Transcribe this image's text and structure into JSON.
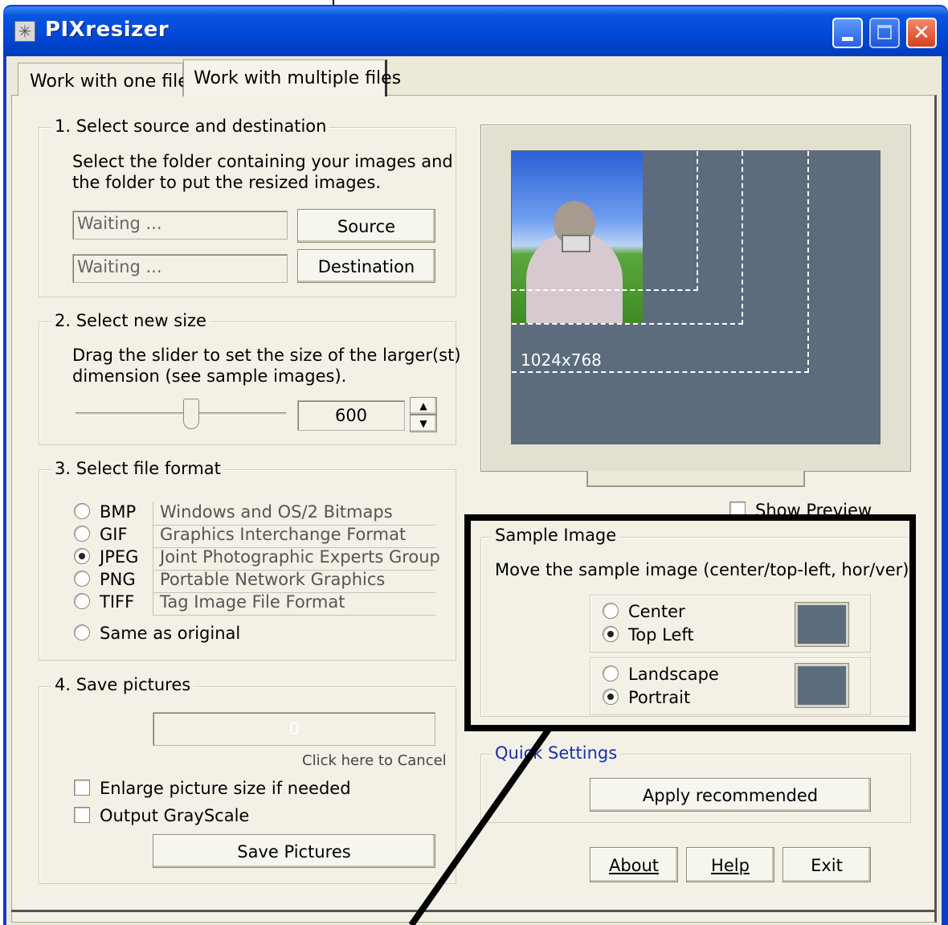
{
  "window": {
    "title": "PIXresizer"
  },
  "tabs": [
    {
      "label": "Work with one file"
    },
    {
      "label": "Work with multiple files"
    }
  ],
  "step1": {
    "legend": "1. Select source and destination",
    "instructions_line1": "Select the folder containing your images and",
    "instructions_line2": "the folder to put the resized images.",
    "source_value": "Waiting ...",
    "destination_value": "Waiting ...",
    "source_button": "Source",
    "destination_button": "Destination"
  },
  "step2": {
    "legend": "2. Select new size",
    "instructions_line1": "Drag the slider to set the size of the larger(st)",
    "instructions_line2": "dimension (see sample images).",
    "size_value": "600"
  },
  "step3": {
    "legend": "3. Select file format",
    "formats": [
      {
        "name": "BMP",
        "desc": "Windows and OS/2 Bitmaps",
        "selected": false
      },
      {
        "name": "GIF",
        "desc": "Graphics Interchange Format",
        "selected": false
      },
      {
        "name": "JPEG",
        "desc": "Joint Photographic Experts Group",
        "selected": true
      },
      {
        "name": "PNG",
        "desc": "Portable Network Graphics",
        "selected": false
      },
      {
        "name": "TIFF",
        "desc": "Tag Image File Format",
        "selected": false
      }
    ],
    "same_as_original": "Same as original"
  },
  "step4": {
    "legend": "4. Save pictures",
    "progress_value": "0",
    "cancel_text": "Click here to Cancel",
    "enlarge_label": "Enlarge picture size if needed",
    "grayscale_label": "Output GrayScale",
    "save_button": "Save Pictures"
  },
  "preview": {
    "resolution_label": "1024x768",
    "show_preview_label": "Show Preview"
  },
  "sample_image": {
    "legend": "Sample Image",
    "description": "Move the sample image (center/top-left, hor/ver).",
    "position_options": [
      {
        "label": "Center",
        "selected": false
      },
      {
        "label": "Top Left",
        "selected": true
      }
    ],
    "orientation_options": [
      {
        "label": "Landscape",
        "selected": false
      },
      {
        "label": "Portrait",
        "selected": true
      }
    ]
  },
  "quick_settings": {
    "legend": "Quick Settings",
    "apply_button": "Apply recommended"
  },
  "footer": {
    "about_button": "About",
    "help_button": "Help",
    "exit_button": "Exit"
  },
  "colors": {
    "title_bar": "#0a55e0",
    "panel": "#f3f1e6",
    "preview_screen": "#5c6c7d",
    "highlight_box": "#000000"
  }
}
